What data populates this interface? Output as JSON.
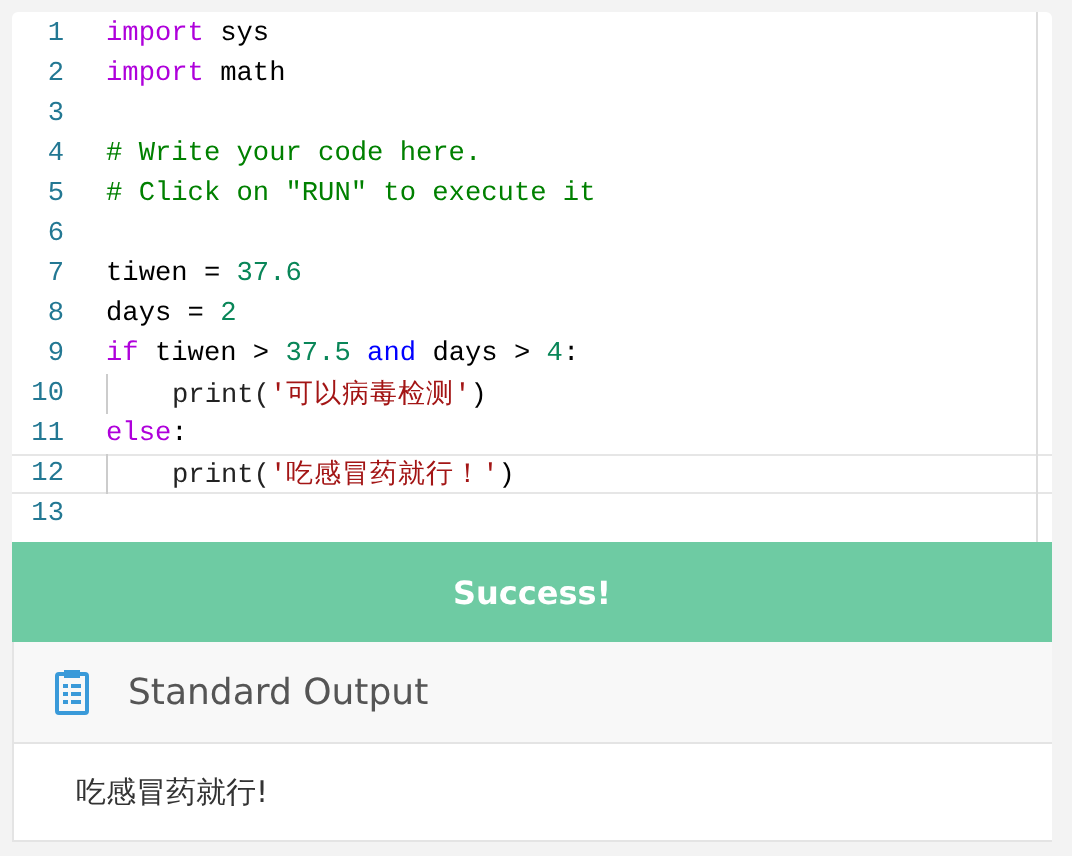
{
  "editor": {
    "lines": [
      {
        "number": "1",
        "current": false,
        "indented": false,
        "tokens": [
          {
            "kind": "keyword",
            "text": "import"
          },
          {
            "kind": "plain",
            "text": " sys"
          }
        ]
      },
      {
        "number": "2",
        "current": false,
        "indented": false,
        "tokens": [
          {
            "kind": "keyword",
            "text": "import"
          },
          {
            "kind": "plain",
            "text": " math"
          }
        ]
      },
      {
        "number": "3",
        "current": false,
        "indented": false
      },
      {
        "number": "4",
        "current": false,
        "indented": false,
        "tokens": [
          {
            "kind": "comment",
            "text": "# Write your code here."
          }
        ]
      },
      {
        "number": "5",
        "current": false,
        "indented": false,
        "tokens": [
          {
            "kind": "comment",
            "text": "# Click on \"RUN\" to execute it"
          }
        ]
      },
      {
        "number": "6",
        "current": false,
        "indented": false
      },
      {
        "number": "7",
        "current": false,
        "indented": false,
        "tokens": [
          {
            "kind": "plain",
            "text": "tiwen = "
          },
          {
            "kind": "number",
            "text": "37.6"
          }
        ]
      },
      {
        "number": "8",
        "current": false,
        "indented": false,
        "tokens": [
          {
            "kind": "plain",
            "text": "days = "
          },
          {
            "kind": "number",
            "text": "2"
          }
        ]
      },
      {
        "number": "9",
        "current": false,
        "indented": false,
        "tokens": [
          {
            "kind": "keyword",
            "text": "if"
          },
          {
            "kind": "plain",
            "text": " tiwen > "
          },
          {
            "kind": "number",
            "text": "37.5"
          },
          {
            "kind": "operator",
            "text": " and"
          },
          {
            "kind": "plain",
            "text": " days > "
          },
          {
            "kind": "number",
            "text": "4"
          },
          {
            "kind": "plain",
            "text": ":"
          }
        ]
      },
      {
        "number": "10",
        "current": false,
        "indented": true,
        "tokens": [
          {
            "kind": "call",
            "text": "print("
          },
          {
            "kind": "string",
            "text": "'可以病毒检测'"
          },
          {
            "kind": "plain",
            "text": ")"
          }
        ]
      },
      {
        "number": "11",
        "current": false,
        "indented": false,
        "tokens": [
          {
            "kind": "keyword",
            "text": "else"
          },
          {
            "kind": "plain",
            "text": ":"
          }
        ]
      },
      {
        "number": "12",
        "current": true,
        "indented": true,
        "tokens": [
          {
            "kind": "call",
            "text": "print("
          },
          {
            "kind": "string",
            "text": "'吃感冒药就行！'"
          },
          {
            "kind": "plain",
            "text": ")"
          }
        ]
      },
      {
        "number": "13",
        "current": false,
        "indented": false
      }
    ]
  },
  "status": {
    "kind": "success",
    "text": "Success!"
  },
  "output": {
    "title": "Standard Output",
    "text": "吃感冒药就行!"
  }
}
